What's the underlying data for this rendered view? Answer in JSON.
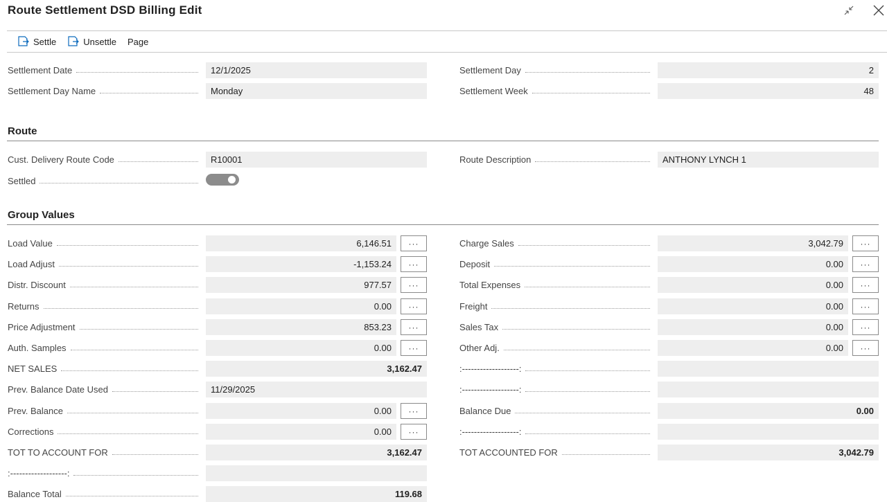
{
  "window": {
    "title": "Route Settlement DSD Billing Edit"
  },
  "actions": {
    "settle": "Settle",
    "unsettle": "Unsettle",
    "page": "Page"
  },
  "general": {
    "settlement_date_label": "Settlement Date",
    "settlement_date": "12/1/2025",
    "settlement_day_label": "Settlement Day",
    "settlement_day": "2",
    "day_name_label": "Settlement Day Name",
    "day_name": "Monday",
    "settlement_week_label": "Settlement Week",
    "settlement_week": "48"
  },
  "route": {
    "heading": "Route",
    "code_label": "Cust. Delivery Route Code",
    "code": "R10001",
    "description_label": "Route Description",
    "description": "ANTHONY LYNCH 1",
    "settled_label": "Settled",
    "settled": true
  },
  "group_values": {
    "heading": "Group Values",
    "left": [
      {
        "label": "Load Value",
        "value": "6,146.51",
        "more": "···",
        "bold": false
      },
      {
        "label": "Load Adjust",
        "value": "-1,153.24",
        "more": "···",
        "bold": false
      },
      {
        "label": "Distr. Discount",
        "value": "977.57",
        "more": "···",
        "bold": false
      },
      {
        "label": "Returns",
        "value": "0.00",
        "more": "···",
        "bold": false
      },
      {
        "label": "Price Adjustment",
        "value": "853.23",
        "more": "···",
        "bold": false
      },
      {
        "label": "Auth. Samples",
        "value": "0.00",
        "more": "···",
        "bold": false
      },
      {
        "label": "NET SALES",
        "value": "3,162.47",
        "more": "",
        "bold": true
      },
      {
        "label": "Prev. Balance Date Used",
        "value": "11/29/2025",
        "more": "",
        "bold": false,
        "align": "left"
      },
      {
        "label": "Prev. Balance",
        "value": "0.00",
        "more": "···",
        "bold": false
      },
      {
        "label": "Corrections",
        "value": "0.00",
        "more": "···",
        "bold": false
      },
      {
        "label": "TOT TO ACCOUNT FOR",
        "value": "3,162.47",
        "more": "",
        "bold": true
      },
      {
        "label": ":-------------------:",
        "value": "",
        "more": "",
        "bold": false
      },
      {
        "label": "Balance Total",
        "value": "119.68",
        "more": "",
        "bold": true
      }
    ],
    "right": [
      {
        "label": "Charge Sales",
        "value": "3,042.79",
        "more": "···",
        "bold": false
      },
      {
        "label": "Deposit",
        "value": "0.00",
        "more": "···",
        "bold": false
      },
      {
        "label": "Total Expenses",
        "value": "0.00",
        "more": "···",
        "bold": false
      },
      {
        "label": "Freight",
        "value": "0.00",
        "more": "···",
        "bold": false
      },
      {
        "label": "Sales Tax",
        "value": "0.00",
        "more": "···",
        "bold": false
      },
      {
        "label": "Other Adj.",
        "value": "0.00",
        "more": "···",
        "bold": false
      },
      {
        "label": ":-------------------:",
        "value": "",
        "more": "",
        "bold": false
      },
      {
        "label": ":-------------------:",
        "value": "",
        "more": "",
        "bold": false
      },
      {
        "label": "Balance Due",
        "value": "0.00",
        "more": "",
        "bold": true
      },
      {
        "label": ":-------------------:",
        "value": "",
        "more": "",
        "bold": false
      },
      {
        "label": "TOT ACCOUNTED FOR",
        "value": "3,042.79",
        "more": "",
        "bold": true
      }
    ]
  }
}
